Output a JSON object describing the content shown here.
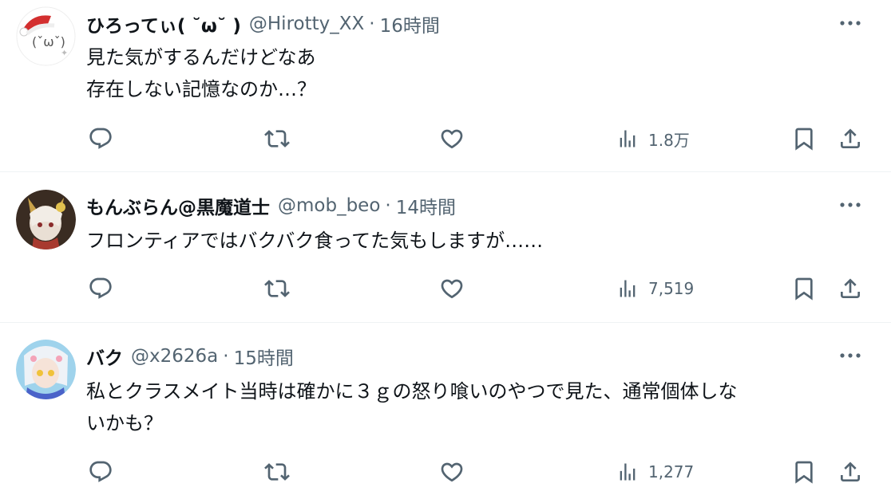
{
  "tweets": [
    {
      "name": "ひろってぃ( ˘ω˘ )",
      "handle": "@Hirotty_XX",
      "separator": "·",
      "time": "16時間",
      "lines": [
        "見た気がするんだけどなあ",
        "存在しない記憶なのか…？"
      ],
      "views": "1.8万",
      "avatar": "santa-hat-face"
    },
    {
      "name": "もんぶらん@黒魔道士",
      "handle": "@mob_beo",
      "separator": "·",
      "time": "14時間",
      "lines": [
        "フロンティアではバクバク食ってた気もしますが……"
      ],
      "views": "7,519",
      "avatar": "anime-character"
    },
    {
      "name": "バク",
      "handle": "@x2626a",
      "separator": "·",
      "time": "15時間",
      "lines": [
        "私とクラスメイト当時は確かに３ｇの怒り喰いのやつで見た、通常個体しな",
        "いかも？"
      ],
      "views": "1,277",
      "avatar": "anime-character"
    }
  ],
  "icons": {
    "reply": "reply-icon",
    "retweet": "retweet-icon",
    "like": "like-icon",
    "views": "views-icon",
    "bookmark": "bookmark-icon",
    "share": "share-icon",
    "more": "more-icon"
  },
  "colors": {
    "text": "#0f1419",
    "secondary": "#536471",
    "divider": "#eff3f4"
  }
}
